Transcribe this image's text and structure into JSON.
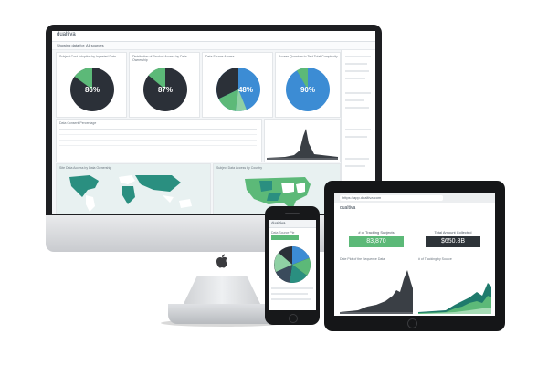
{
  "imac": {
    "logo": "dualtiva",
    "filter_text": "Showing data for: All sources",
    "panels": [
      {
        "title": "Subject Cost Adoption by Ingested Data"
      },
      {
        "title": "Distribution of Product Access by Data Ownership"
      },
      {
        "title": "Data Source Access"
      },
      {
        "title": "Access Quantum to Test Total Complexity"
      }
    ],
    "pie_values": [
      "86%",
      "87%",
      "48%",
      "90%"
    ],
    "table_title": "Data Consent Percentage",
    "map_title_left": "Site Data Access by Data Ownership",
    "map_title_right": "Subject Data Access by Country",
    "bottom_title": "Total Data Access by Distribution Type",
    "colors": {
      "dark": "#2b3038",
      "green": "#5cb978",
      "blue": "#3c8cd4",
      "teal": "#2a8f80"
    }
  },
  "phone": {
    "logo": "dualtiva",
    "title": "Data Source Pie"
  },
  "tablet": {
    "logo": "dualtiva",
    "url": "https://app.dualtiva.com",
    "kpi_left_label": "# of Tracking Subjects",
    "kpi_left_value": "83,870",
    "kpi_right_label": "Total Amount Collected",
    "kpi_right_value": "$650.8B",
    "chart_left_title": "Date Plot of the Sequence Data",
    "chart_right_title": "# of Tracking by Source"
  }
}
